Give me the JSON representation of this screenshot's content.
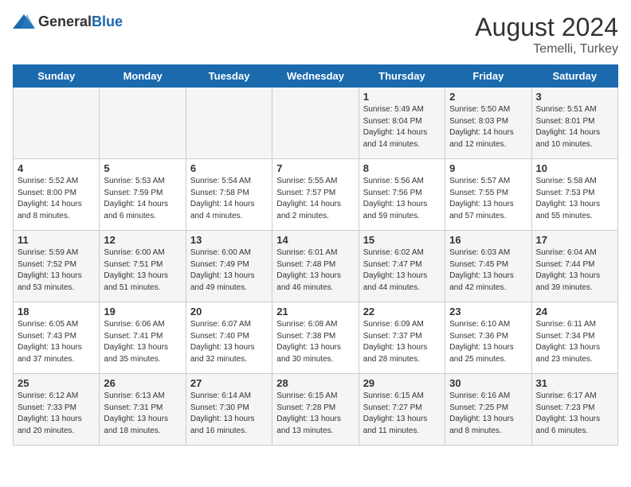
{
  "header": {
    "logo_general": "General",
    "logo_blue": "Blue",
    "month_year": "August 2024",
    "location": "Temelli, Turkey"
  },
  "days_of_week": [
    "Sunday",
    "Monday",
    "Tuesday",
    "Wednesday",
    "Thursday",
    "Friday",
    "Saturday"
  ],
  "weeks": [
    [
      {
        "day": "",
        "info": ""
      },
      {
        "day": "",
        "info": ""
      },
      {
        "day": "",
        "info": ""
      },
      {
        "day": "",
        "info": ""
      },
      {
        "day": "1",
        "info": "Sunrise: 5:49 AM\nSunset: 8:04 PM\nDaylight: 14 hours\nand 14 minutes."
      },
      {
        "day": "2",
        "info": "Sunrise: 5:50 AM\nSunset: 8:03 PM\nDaylight: 14 hours\nand 12 minutes."
      },
      {
        "day": "3",
        "info": "Sunrise: 5:51 AM\nSunset: 8:01 PM\nDaylight: 14 hours\nand 10 minutes."
      }
    ],
    [
      {
        "day": "4",
        "info": "Sunrise: 5:52 AM\nSunset: 8:00 PM\nDaylight: 14 hours\nand 8 minutes."
      },
      {
        "day": "5",
        "info": "Sunrise: 5:53 AM\nSunset: 7:59 PM\nDaylight: 14 hours\nand 6 minutes."
      },
      {
        "day": "6",
        "info": "Sunrise: 5:54 AM\nSunset: 7:58 PM\nDaylight: 14 hours\nand 4 minutes."
      },
      {
        "day": "7",
        "info": "Sunrise: 5:55 AM\nSunset: 7:57 PM\nDaylight: 14 hours\nand 2 minutes."
      },
      {
        "day": "8",
        "info": "Sunrise: 5:56 AM\nSunset: 7:56 PM\nDaylight: 13 hours\nand 59 minutes."
      },
      {
        "day": "9",
        "info": "Sunrise: 5:57 AM\nSunset: 7:55 PM\nDaylight: 13 hours\nand 57 minutes."
      },
      {
        "day": "10",
        "info": "Sunrise: 5:58 AM\nSunset: 7:53 PM\nDaylight: 13 hours\nand 55 minutes."
      }
    ],
    [
      {
        "day": "11",
        "info": "Sunrise: 5:59 AM\nSunset: 7:52 PM\nDaylight: 13 hours\nand 53 minutes."
      },
      {
        "day": "12",
        "info": "Sunrise: 6:00 AM\nSunset: 7:51 PM\nDaylight: 13 hours\nand 51 minutes."
      },
      {
        "day": "13",
        "info": "Sunrise: 6:00 AM\nSunset: 7:49 PM\nDaylight: 13 hours\nand 49 minutes."
      },
      {
        "day": "14",
        "info": "Sunrise: 6:01 AM\nSunset: 7:48 PM\nDaylight: 13 hours\nand 46 minutes."
      },
      {
        "day": "15",
        "info": "Sunrise: 6:02 AM\nSunset: 7:47 PM\nDaylight: 13 hours\nand 44 minutes."
      },
      {
        "day": "16",
        "info": "Sunrise: 6:03 AM\nSunset: 7:45 PM\nDaylight: 13 hours\nand 42 minutes."
      },
      {
        "day": "17",
        "info": "Sunrise: 6:04 AM\nSunset: 7:44 PM\nDaylight: 13 hours\nand 39 minutes."
      }
    ],
    [
      {
        "day": "18",
        "info": "Sunrise: 6:05 AM\nSunset: 7:43 PM\nDaylight: 13 hours\nand 37 minutes."
      },
      {
        "day": "19",
        "info": "Sunrise: 6:06 AM\nSunset: 7:41 PM\nDaylight: 13 hours\nand 35 minutes."
      },
      {
        "day": "20",
        "info": "Sunrise: 6:07 AM\nSunset: 7:40 PM\nDaylight: 13 hours\nand 32 minutes."
      },
      {
        "day": "21",
        "info": "Sunrise: 6:08 AM\nSunset: 7:38 PM\nDaylight: 13 hours\nand 30 minutes."
      },
      {
        "day": "22",
        "info": "Sunrise: 6:09 AM\nSunset: 7:37 PM\nDaylight: 13 hours\nand 28 minutes."
      },
      {
        "day": "23",
        "info": "Sunrise: 6:10 AM\nSunset: 7:36 PM\nDaylight: 13 hours\nand 25 minutes."
      },
      {
        "day": "24",
        "info": "Sunrise: 6:11 AM\nSunset: 7:34 PM\nDaylight: 13 hours\nand 23 minutes."
      }
    ],
    [
      {
        "day": "25",
        "info": "Sunrise: 6:12 AM\nSunset: 7:33 PM\nDaylight: 13 hours\nand 20 minutes."
      },
      {
        "day": "26",
        "info": "Sunrise: 6:13 AM\nSunset: 7:31 PM\nDaylight: 13 hours\nand 18 minutes."
      },
      {
        "day": "27",
        "info": "Sunrise: 6:14 AM\nSunset: 7:30 PM\nDaylight: 13 hours\nand 16 minutes."
      },
      {
        "day": "28",
        "info": "Sunrise: 6:15 AM\nSunset: 7:28 PM\nDaylight: 13 hours\nand 13 minutes."
      },
      {
        "day": "29",
        "info": "Sunrise: 6:15 AM\nSunset: 7:27 PM\nDaylight: 13 hours\nand 11 minutes."
      },
      {
        "day": "30",
        "info": "Sunrise: 6:16 AM\nSunset: 7:25 PM\nDaylight: 13 hours\nand 8 minutes."
      },
      {
        "day": "31",
        "info": "Sunrise: 6:17 AM\nSunset: 7:23 PM\nDaylight: 13 hours\nand 6 minutes."
      }
    ]
  ]
}
